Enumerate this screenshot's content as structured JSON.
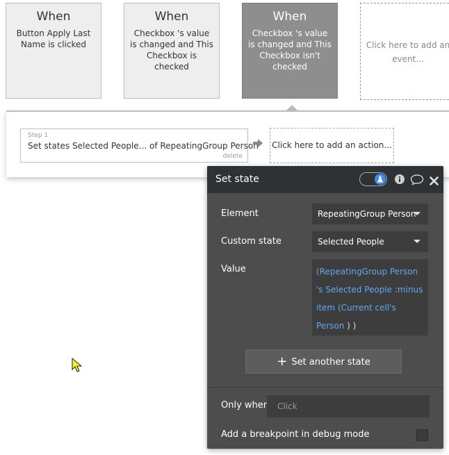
{
  "events": [
    {
      "when": "When",
      "description": "Button Apply Last Name is clicked"
    },
    {
      "when": "When",
      "description": "Checkbox 's value is changed and This Checkbox is checked"
    },
    {
      "when": "When",
      "description": "Checkbox 's value is changed and This Checkbox isn't checked"
    }
  ],
  "add_event": "Click here to add an event...",
  "step": {
    "number": "Step 1",
    "title": "Set states Selected People... of RepeatingGroup Person",
    "delete": "delete"
  },
  "add_action": "Click here to add an action...",
  "popup": {
    "title": "Set state",
    "element_label": "Element",
    "element_value": "RepeatingGroup Person",
    "custom_state_label": "Custom state",
    "custom_state_value": "Selected People",
    "value_label": "Value",
    "value_expr": {
      "open1": "(",
      "ref1": "RepeatingGroup Person 's Selected People :minus item",
      "open2": " (",
      "ref2": "Current cell's Person",
      "close": " ) )"
    },
    "set_another_label": "Set another state",
    "only_when_label": "Only when",
    "only_when_placeholder": "Click",
    "breakpoint_label": "Add a breakpoint in debug mode"
  },
  "colors": {
    "active_event": "#8e8e8e",
    "popup_bg": "#4d4d4d",
    "header_bg": "#2f3235",
    "link_blue": "#64a6f0",
    "toggle_blue": "#3b8ef0"
  },
  "icons": [
    "arrow-right-icon",
    "flask-icon",
    "info-icon",
    "comment-icon",
    "close-icon",
    "plus-icon",
    "chevron-down-icon",
    "mouse-cursor-icon"
  ]
}
